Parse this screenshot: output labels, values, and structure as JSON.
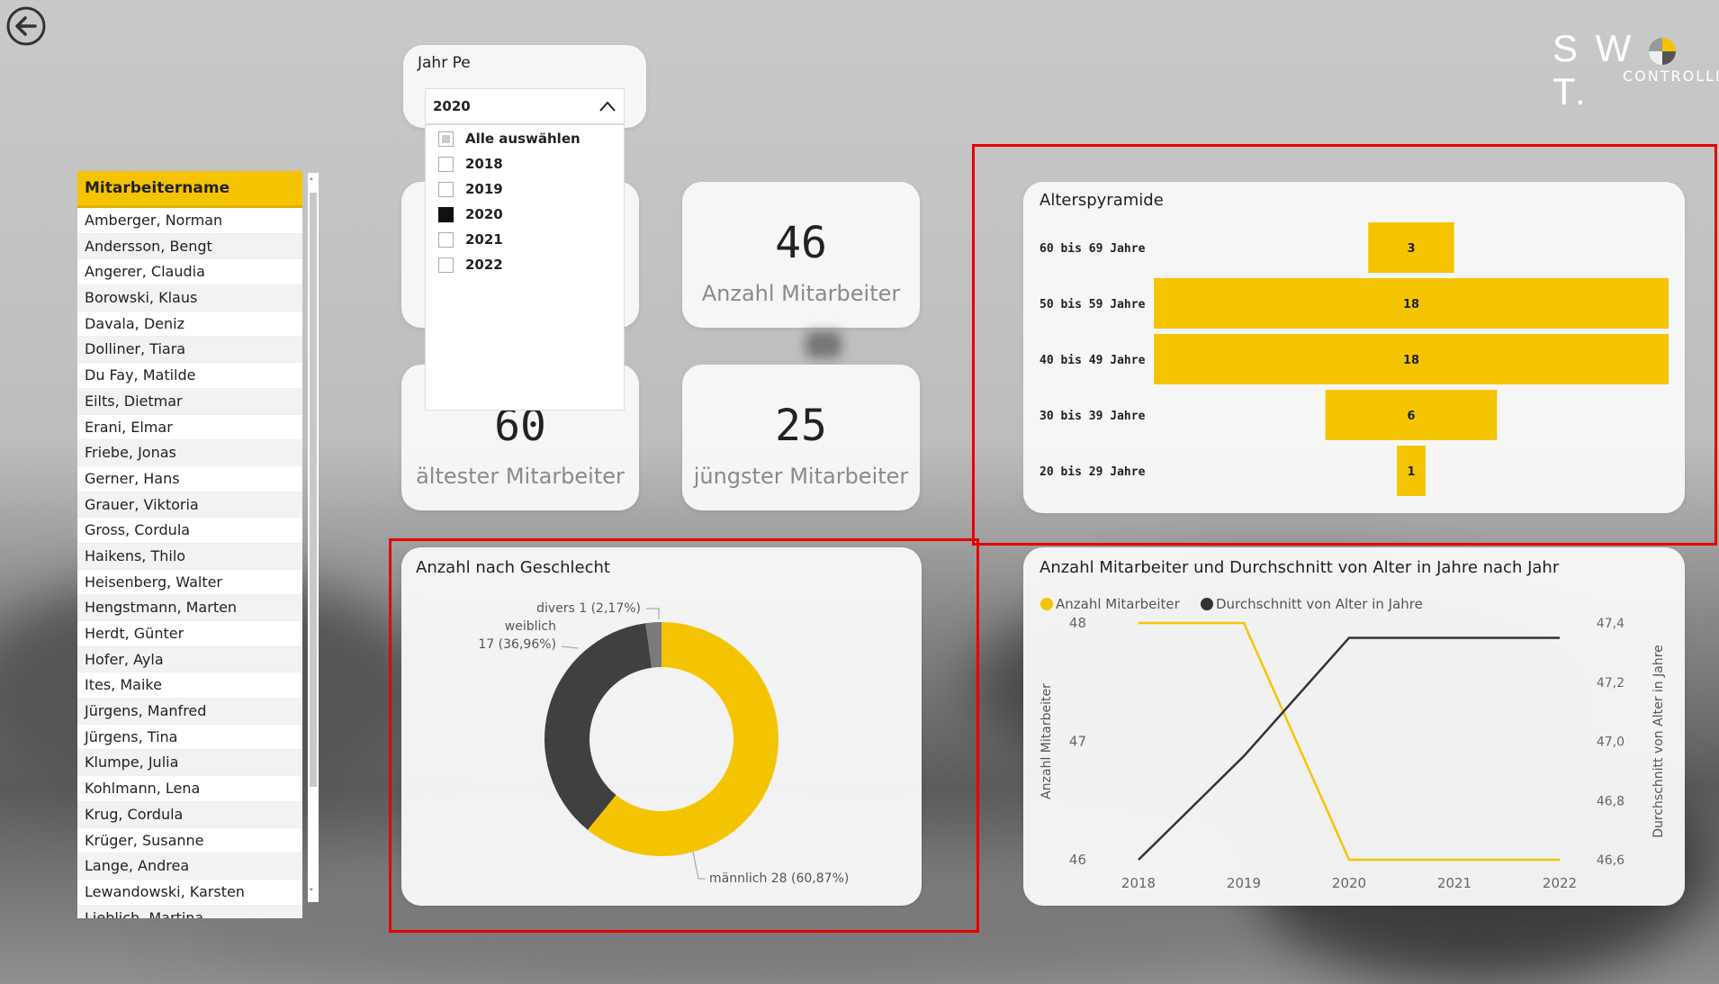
{
  "logo": {
    "text": "SW  T.",
    "sub": "CONTROLLI"
  },
  "back_icon": "arrow-left-circle-icon",
  "employee_list": {
    "header": "Mitarbeitername",
    "names": [
      "Amberger, Norman",
      "Andersson, Bengt",
      "Angerer, Claudia",
      "Borowski, Klaus",
      "Davala, Deniz",
      "Dolliner, Tiara",
      "Du Fay, Matilde",
      "Eilts, Dietmar",
      "Erani, Elmar",
      "Friebe, Jonas",
      "Gerner, Hans",
      "Grauer, Viktoria",
      "Gross, Cordula",
      "Haikens, Thilo",
      "Heisenberg, Walter",
      "Hengstmann, Marten",
      "Herdt, Günter",
      "Hofer, Ayla",
      "Ites, Maike",
      "Jürgens, Manfred",
      "Jürgens, Tina",
      "Klumpe, Julia",
      "Kohlmann, Lena",
      "Krug, Cordula",
      "Krüger, Susanne",
      "Lange, Andrea",
      "Lewandowski, Karsten",
      "Lieblich, Martina"
    ]
  },
  "year_filter": {
    "title": "Jahr Pe",
    "selected": "2020",
    "options": [
      {
        "label": "Alle auswählen",
        "state": "partial"
      },
      {
        "label": "2018",
        "state": "unchecked"
      },
      {
        "label": "2019",
        "state": "unchecked"
      },
      {
        "label": "2020",
        "state": "checked"
      },
      {
        "label": "2021",
        "state": "unchecked"
      },
      {
        "label": "2022",
        "state": "unchecked"
      }
    ]
  },
  "kpis": {
    "count": {
      "value": "46",
      "label": "Anzahl Mitarbeiter"
    },
    "oldest": {
      "value": "60",
      "label": "ältester Mitarbeiter"
    },
    "youngest": {
      "value": "25",
      "label": "jüngster Mitarbeiter"
    }
  },
  "colors": {
    "accent": "#f5c400",
    "dark": "#404040",
    "grey": "#7a7a7a",
    "highlight": "#e60000"
  },
  "chart_data": [
    {
      "type": "bar",
      "title": "Alterspyramide",
      "categories": [
        "60 bis 69 Jahre",
        "50 bis 59 Jahre",
        "40 bis 49 Jahre",
        "30 bis 39 Jahre",
        "20 bis 29 Jahre"
      ],
      "values": [
        3,
        18,
        18,
        6,
        1
      ],
      "orientation": "horizontal-centered"
    },
    {
      "type": "pie",
      "title": "Anzahl nach Geschlecht",
      "donut": true,
      "slices": [
        {
          "name": "männlich",
          "value": 28,
          "label": "männlich 28 (60,87%)"
        },
        {
          "name": "weiblich",
          "value": 17,
          "label": "weiblich\n17 (36,96%)",
          "label_line1": "weiblich",
          "label_line2": "17 (36,96%)"
        },
        {
          "name": "divers",
          "value": 1,
          "label": "divers 1 (2,17%)"
        }
      ]
    },
    {
      "type": "line",
      "title": "Anzahl Mitarbeiter und Durchschnitt von Alter in Jahre nach Jahr",
      "x": [
        "2018",
        "2019",
        "2020",
        "2021",
        "2022"
      ],
      "series": [
        {
          "name": "Anzahl Mitarbeiter",
          "axis": "left",
          "values": [
            48,
            48,
            46,
            46,
            46
          ]
        },
        {
          "name": "Durchschnitt von Alter in Jahre",
          "axis": "right",
          "values": [
            46.6,
            46.95,
            47.35,
            47.35,
            47.35
          ]
        }
      ],
      "ylabel": "Anzahl Mitarbeiter",
      "y2label": "Durchschnitt von Alter in Jahre",
      "yticks": [
        "48",
        "47",
        "46"
      ],
      "y2ticks": [
        "47,4",
        "47,2",
        "47,0",
        "46,8",
        "46,6"
      ],
      "ylim": [
        46,
        48
      ],
      "y2lim": [
        46.6,
        47.4
      ],
      "legend": "top-left"
    }
  ]
}
